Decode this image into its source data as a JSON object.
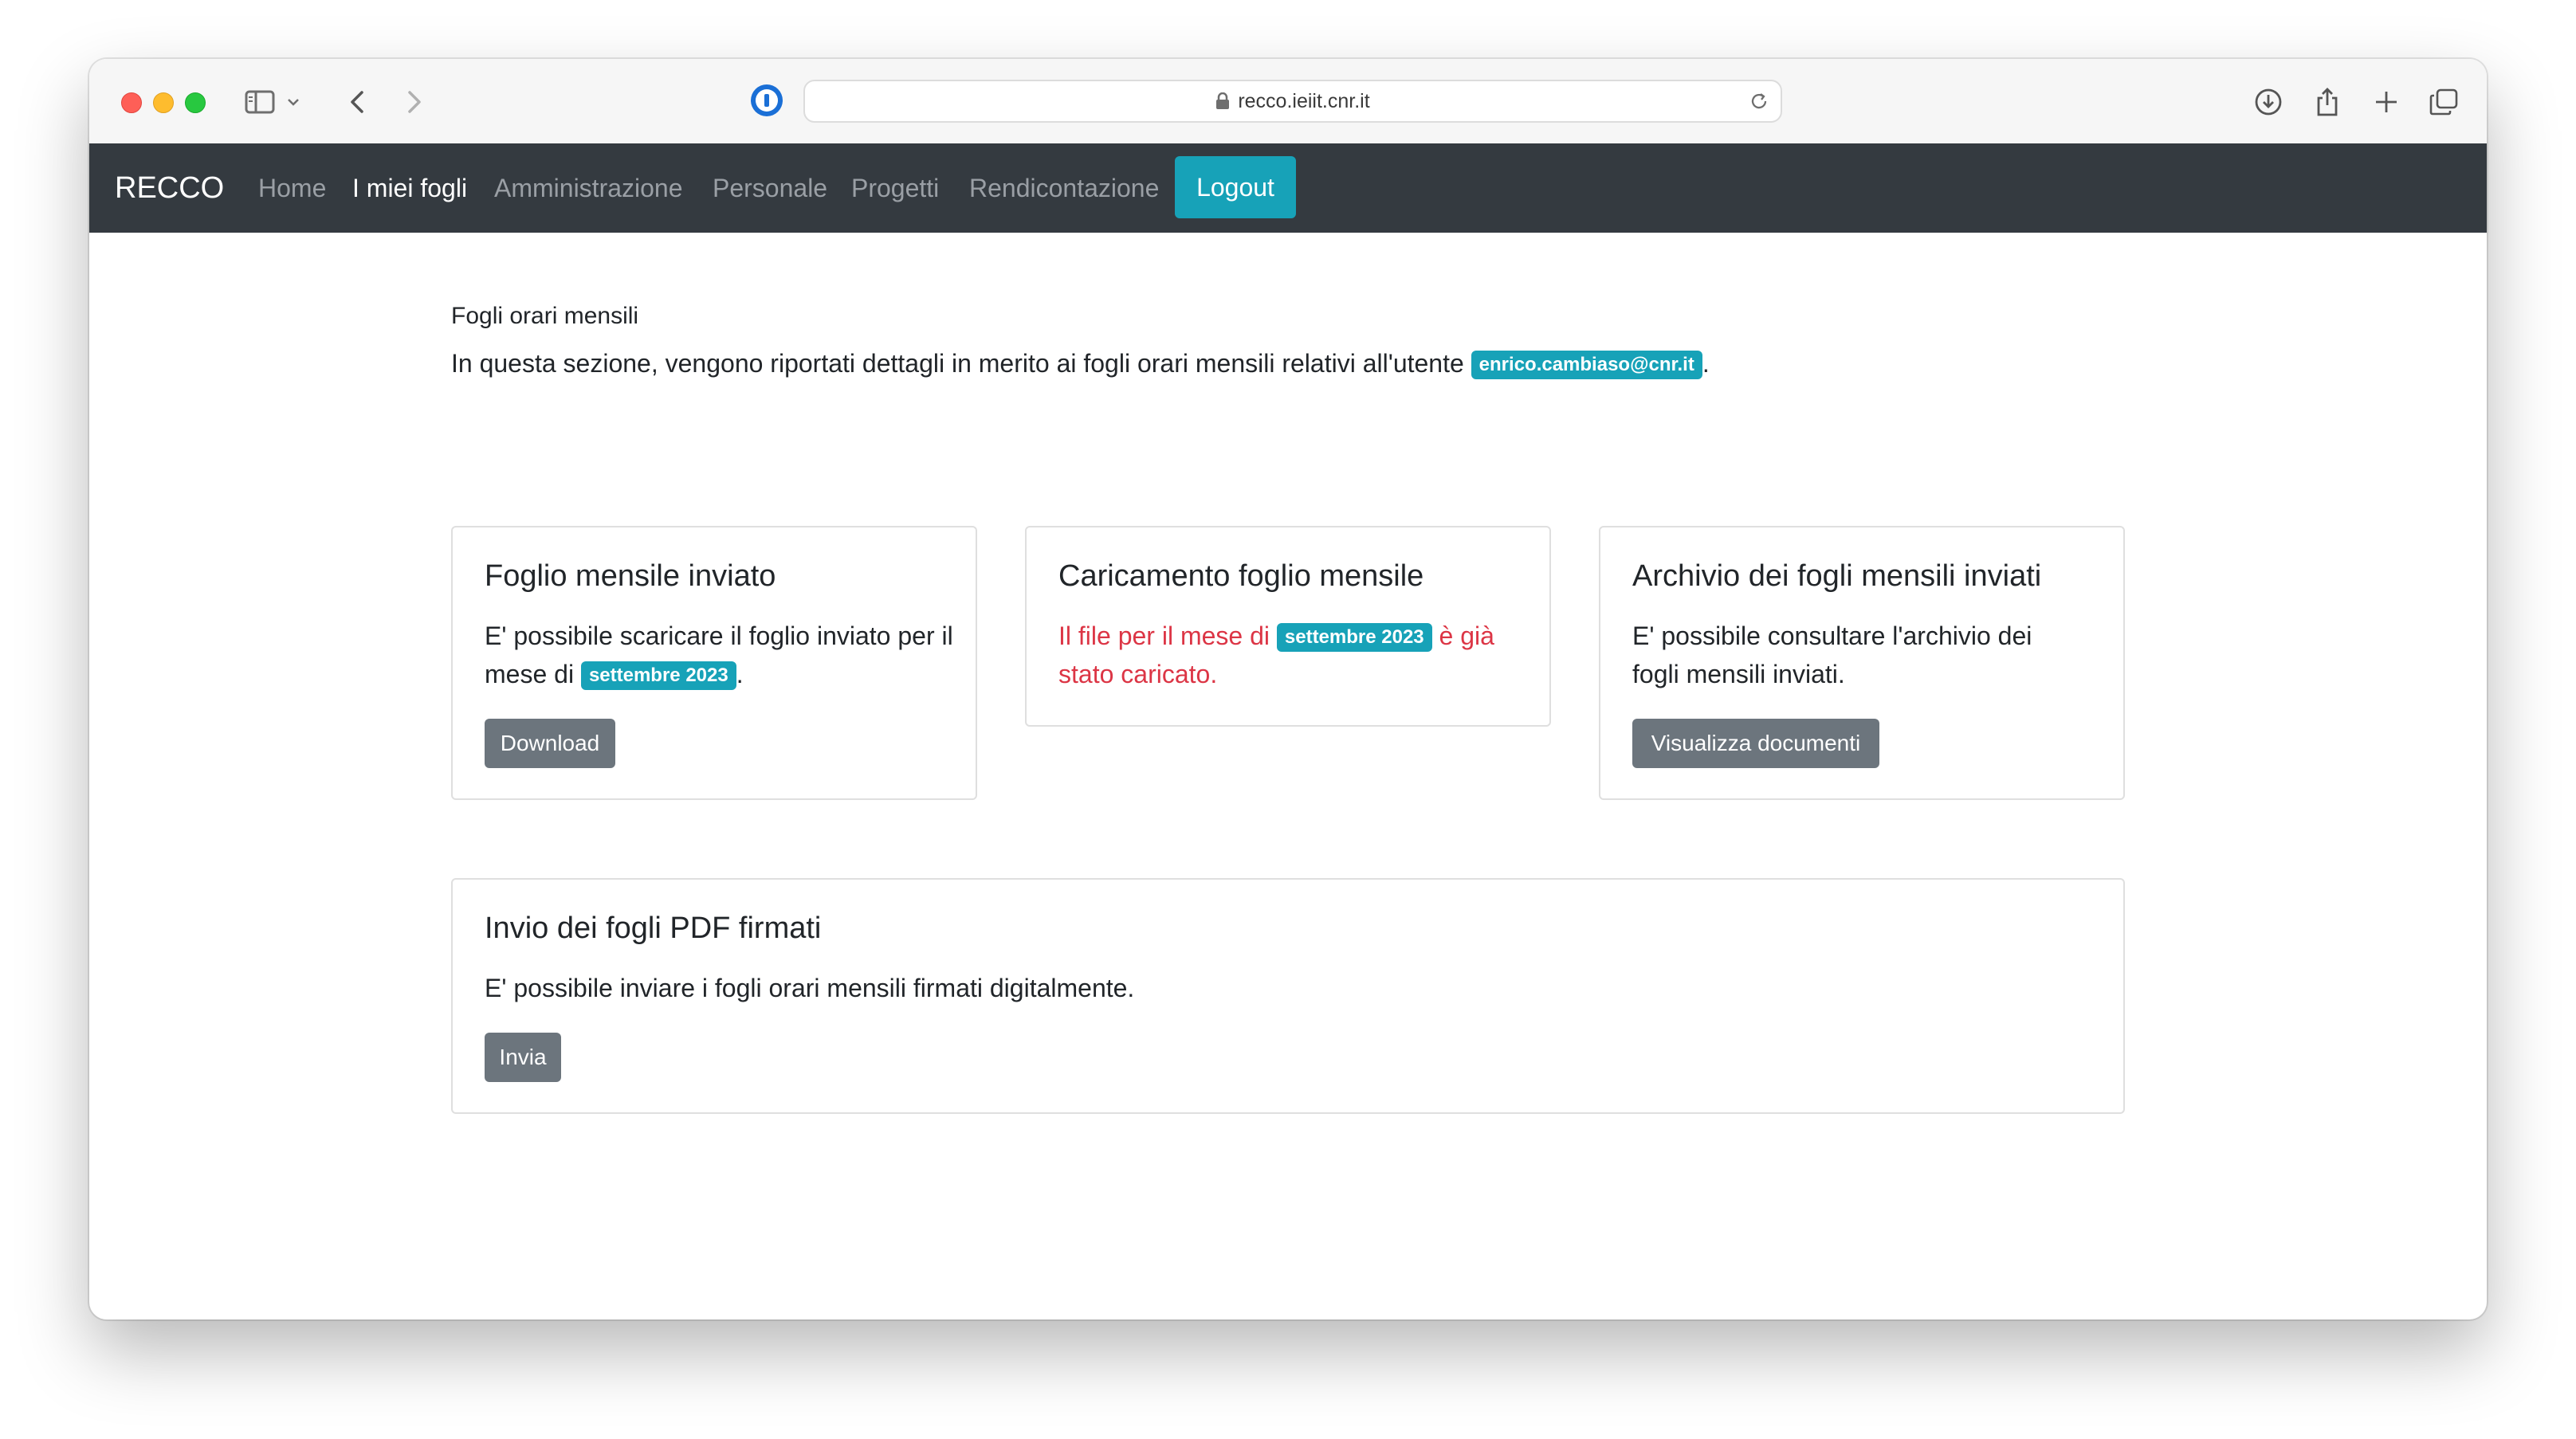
{
  "browser": {
    "url": "recco.ieiit.cnr.it",
    "icons": [
      "sidebar-icon",
      "chevron-down-icon",
      "back-icon",
      "forward-icon",
      "password-manager-icon",
      "lock-icon",
      "reload-icon",
      "download-icon",
      "share-icon",
      "new-tab-icon",
      "tabs-overview-icon"
    ]
  },
  "navbar": {
    "brand": "RECCO",
    "links": [
      "Home",
      "I miei fogli",
      "Amministrazione",
      "Personale",
      "Progetti",
      "Rendicontazione"
    ],
    "active": "I miei fogli",
    "logout_label": "Logout"
  },
  "page": {
    "heading": "Fogli orari mensili",
    "intro_text": "In questa sezione, vengono riportati dettagli in merito ai fogli orari mensili relativi all'utente",
    "user_badge": "enrico.cambiaso@cnr.it",
    "intro_end": "."
  },
  "cards": {
    "sent": {
      "title": "Foglio mensile inviato",
      "text_before": "E' possibile scaricare il foglio inviato per il mese di",
      "month_badge": "settembre 2023",
      "text_after": ".",
      "button": "Download"
    },
    "upload": {
      "title": "Caricamento foglio mensile",
      "text_before": "Il file per il mese di",
      "month_badge": "settembre 2023",
      "text_after": "è già stato caricato."
    },
    "archive": {
      "title": "Archivio dei fogli mensili inviati",
      "text": "E' possibile consultare l'archivio dei fogli mensili inviati.",
      "button": "Visualizza documenti"
    },
    "signed": {
      "title": "Invio dei fogli PDF firmati",
      "text": "E' possibile inviare i fogli orari mensili firmati digitalmente.",
      "button": "Invia"
    }
  },
  "colors": {
    "navbar_bg": "#343a40",
    "accent": "#17a2b8",
    "button_secondary": "#6c757d",
    "danger_text": "#dc3545"
  }
}
